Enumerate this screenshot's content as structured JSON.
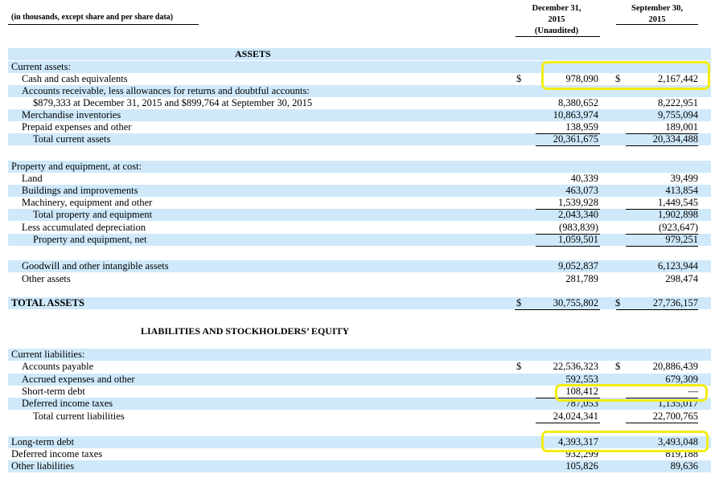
{
  "header": {
    "units_note": "(in thousands, except share and per share data)",
    "col1": [
      "December 31,",
      "2015",
      "(Unaudited)"
    ],
    "col2": [
      "September 30,",
      "2015"
    ]
  },
  "sections": {
    "assets": "ASSETS",
    "liabilities": "LIABILITIES AND STOCKHOLDERS’ EQUITY"
  },
  "currency_symbol": "$",
  "highlight_color": "#f2ec14",
  "rows": [
    {
      "label": "Current assets:",
      "indent": 0,
      "c1": "",
      "c2": ""
    },
    {
      "label": "Cash and cash equivalents",
      "indent": 1,
      "c1": "978,090",
      "c2": "2,167,442",
      "dollar": true
    },
    {
      "label": "Accounts receivable, less allowances for returns and doubtful accounts:",
      "indent": 1,
      "c1": "",
      "c2": ""
    },
    {
      "label": "$879,333 at December 31, 2015 and $899,764 at September 30, 2015",
      "indent": 2,
      "c1": "8,380,652",
      "c2": "8,222,951"
    },
    {
      "label": "Merchandise inventories",
      "indent": 1,
      "c1": "10,863,974",
      "c2": "9,755,094"
    },
    {
      "label": "Prepaid expenses and other",
      "indent": 1,
      "c1": "138,959",
      "c2": "189,001"
    },
    {
      "label": "Total current assets",
      "indent": 2,
      "c1": "20,361,675",
      "c2": "20,334,488"
    },
    {
      "label": "Property and equipment, at cost:",
      "indent": 0,
      "c1": "",
      "c2": ""
    },
    {
      "label": "Land",
      "indent": 1,
      "c1": "40,339",
      "c2": "39,499"
    },
    {
      "label": "Buildings and improvements",
      "indent": 1,
      "c1": "463,073",
      "c2": "413,854"
    },
    {
      "label": "Machinery, equipment and other",
      "indent": 1,
      "c1": "1,539,928",
      "c2": "1,449,545"
    },
    {
      "label": "Total property and equipment",
      "indent": 2,
      "c1": "2,043,340",
      "c2": "1,902,898"
    },
    {
      "label": "Less accumulated depreciation",
      "indent": 1,
      "c1": "(983,839)",
      "c2": "(923,647)"
    },
    {
      "label": "Property and equipment, net",
      "indent": 2,
      "c1": "1,059,501",
      "c2": "979,251"
    },
    {
      "label": "Goodwill and other intangible assets",
      "indent": 1,
      "c1": "9,052,837",
      "c2": "6,123,944"
    },
    {
      "label": "Other assets",
      "indent": 1,
      "c1": "281,789",
      "c2": "298,474"
    },
    {
      "label": "TOTAL ASSETS",
      "indent": 0,
      "c1": "30,755,802",
      "c2": "27,736,157",
      "dollar": true,
      "bold": true
    },
    {
      "label": "Current liabilities:",
      "indent": 0,
      "c1": "",
      "c2": ""
    },
    {
      "label": "Accounts payable",
      "indent": 1,
      "c1": "22,536,323",
      "c2": "20,886,439",
      "dollar": true
    },
    {
      "label": "Accrued expenses and other",
      "indent": 1,
      "c1": "592,553",
      "c2": "679,309"
    },
    {
      "label": "Short-term debt",
      "indent": 1,
      "c1": "108,412",
      "c2": "—"
    },
    {
      "label": "Deferred income taxes",
      "indent": 1,
      "c1": "787,053",
      "c2": "1,135,017"
    },
    {
      "label": "Total current liabilities",
      "indent": 2,
      "c1": "24,024,341",
      "c2": "22,700,765"
    },
    {
      "label": "Long-term debt",
      "indent": 0,
      "c1": "4,393,317",
      "c2": "3,493,048"
    },
    {
      "label": "Deferred income taxes",
      "indent": 0,
      "c1": "932,299",
      "c2": "819,188"
    },
    {
      "label": "Other liabilities",
      "indent": 0,
      "c1": "105,826",
      "c2": "89,636"
    }
  ]
}
